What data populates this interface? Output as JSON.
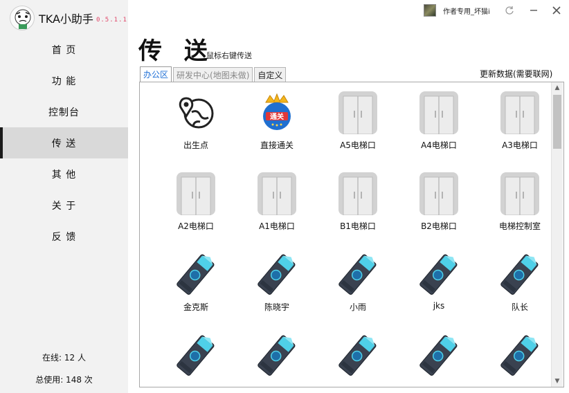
{
  "app": {
    "name": "TKA小助手",
    "version": "0.5.1.1"
  },
  "nav": [
    {
      "label": "首 页",
      "icon": ""
    },
    {
      "label": "功 能",
      "icon": ""
    },
    {
      "label": "控制台",
      "icon": ""
    },
    {
      "label": "传 送",
      "icon": "",
      "active": true
    },
    {
      "label": "其 他",
      "icon": ""
    },
    {
      "label": "关 于",
      "icon": ""
    },
    {
      "label": "反 馈",
      "icon": ""
    }
  ],
  "stats": {
    "online": "在线: 12 人",
    "total": "总使用: 148 次"
  },
  "user": {
    "name": "作者专用_坏猫i"
  },
  "page": {
    "title": "传 送",
    "subtitle": "鼠标右键传送"
  },
  "tabs": [
    {
      "label": "办公区",
      "active": true
    },
    {
      "label": "研发中心(地图未做)",
      "disabled": true
    },
    {
      "label": "自定义"
    }
  ],
  "refresh_label": "更新数据(需要联网)",
  "items": [
    {
      "label": "出生点",
      "icon": "map-pin-icon"
    },
    {
      "label": "直接通关",
      "icon": "crown-badge-icon",
      "badge_text": "通关"
    },
    {
      "label": "A5电梯口",
      "icon": "elevator-icon"
    },
    {
      "label": "A4电梯口",
      "icon": "elevator-icon"
    },
    {
      "label": "A3电梯口",
      "icon": "elevator-icon"
    },
    {
      "label": "A2电梯口",
      "icon": "elevator-icon"
    },
    {
      "label": "A1电梯口",
      "icon": "elevator-icon"
    },
    {
      "label": "B1电梯口",
      "icon": "elevator-icon"
    },
    {
      "label": "B2电梯口",
      "icon": "elevator-icon"
    },
    {
      "label": "电梯控制室",
      "icon": "elevator-icon"
    },
    {
      "label": "金克斯",
      "icon": "keycard-icon"
    },
    {
      "label": "陈晓宇",
      "icon": "keycard-icon"
    },
    {
      "label": "小雨",
      "icon": "keycard-icon"
    },
    {
      "label": "jks",
      "icon": "keycard-icon"
    },
    {
      "label": "队长",
      "icon": "keycard-icon"
    },
    {
      "label": "",
      "icon": "keycard-icon"
    },
    {
      "label": "",
      "icon": "keycard-icon"
    },
    {
      "label": "",
      "icon": "keycard-icon"
    },
    {
      "label": "",
      "icon": "keycard-icon"
    },
    {
      "label": "",
      "icon": "keycard-icon"
    }
  ],
  "colors": {
    "accent": "#1e6fd6",
    "sidebar": "#f2f2f2",
    "active_nav": "#d9d9d9",
    "version": "#e0486a"
  }
}
